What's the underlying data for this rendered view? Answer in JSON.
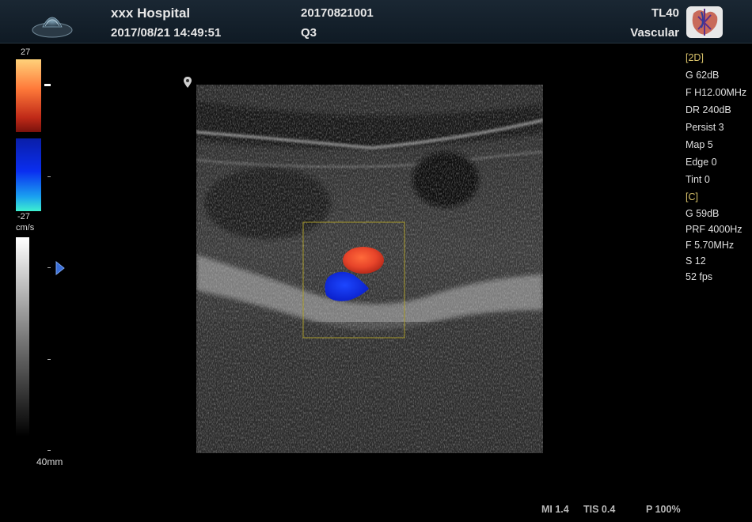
{
  "header": {
    "hospital": "xxx Hospital",
    "datetime": "2017/08/21 14:49:51",
    "patient_id": "20170821001",
    "patient_sub": "Q3",
    "probe": "TL40",
    "preset": "Vascular"
  },
  "color_scale": {
    "max": "27",
    "min": "-27",
    "unit": "cm/s",
    "positive_color": "#e8542a",
    "negative_color": "#0a2ef0"
  },
  "depth": {
    "label": "40mm"
  },
  "params_2d": {
    "heading": "[2D]",
    "items": [
      "G 62dB",
      "F H12.00MHz",
      "DR 240dB",
      "Persist 3",
      "Map 5",
      "Edge 0",
      "Tint 0"
    ]
  },
  "params_color": {
    "heading": "[C]",
    "items": [
      "G 59dB",
      "PRF 4000Hz",
      "F 5.70MHz",
      "S 12",
      "52 fps"
    ]
  },
  "footer": {
    "mi": "MI 1.4",
    "tis": "TIS 0.4",
    "power": "P 100%"
  },
  "icons": {
    "logo": "probe-logo-icon",
    "organ": "vascular-organ-icon",
    "focus": "focus-marker-icon",
    "pin": "location-pin-icon"
  }
}
